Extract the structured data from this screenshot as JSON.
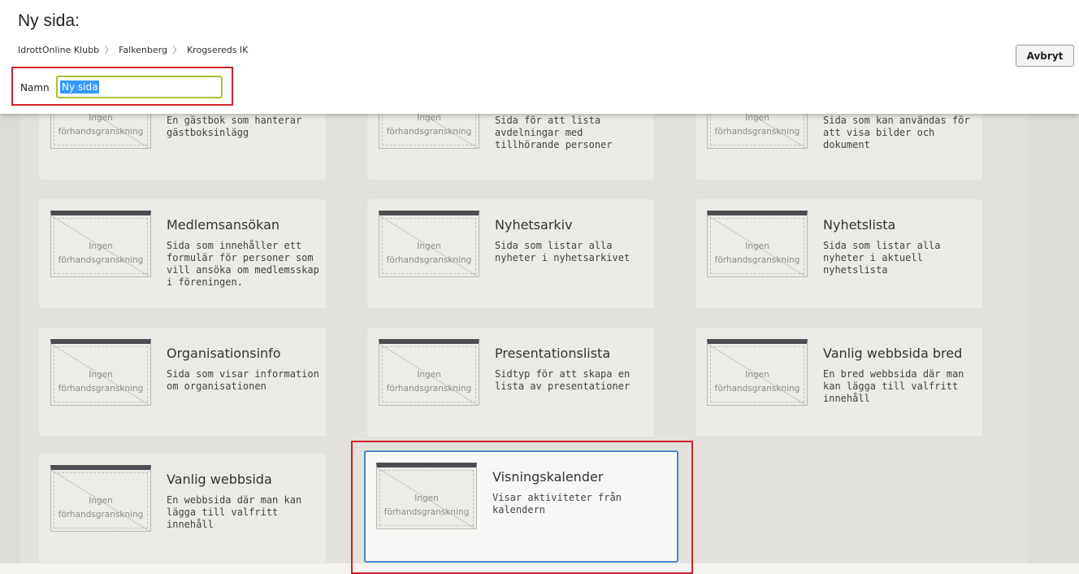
{
  "header": {
    "title": "Ny sida:",
    "breadcrumbs": [
      "IdrottOnline Klubb",
      "Falkenberg",
      "Krogsereds IK"
    ],
    "breadcrumb_separator": "〉",
    "cancel_label": "Avbryt",
    "name_label": "Namn",
    "name_value": "Ny sida"
  },
  "thumbnail_placeholder": [
    "Ingen",
    "förhandsgranskning"
  ],
  "partial_row": [
    {
      "desc": "En gästbok som hanterar gästboksinlägg"
    },
    {
      "desc": "Sida för att lista avdelningar med tillhörande personer"
    },
    {
      "desc": "Sida som kan användas för att visa bilder och dokument"
    }
  ],
  "cards": [
    {
      "title": "Medlemsansökan",
      "desc": "Sida som innehåller ett formulär för personer som vill ansöka om medlemsskap i föreningen."
    },
    {
      "title": "Nyhetsarkiv",
      "desc": "Sida som listar alla nyheter i nyhetsarkivet"
    },
    {
      "title": "Nyhetslista",
      "desc": "Sida som listar alla nyheter i aktuell nyhetslista"
    },
    {
      "title": "Organisationsinfo",
      "desc": "Sida som visar information om organisationen"
    },
    {
      "title": "Presentationslista",
      "desc": "Sidtyp för att skapa en lista av presentationer"
    },
    {
      "title": "Vanlig webbsida bred",
      "desc": "En bred webbsida där man kan lägga till valfritt innehåll"
    },
    {
      "title": "Vanlig webbsida",
      "desc": "En webbsida där man kan lägga till valfritt innehåll"
    },
    {
      "title": "Visningskalender",
      "desc": "Visar aktiviteter från kalendern",
      "selected": true
    }
  ],
  "colors": {
    "highlight": "#d4202a",
    "selection_border": "#4a86c8",
    "input_border": "#a9c03a"
  }
}
